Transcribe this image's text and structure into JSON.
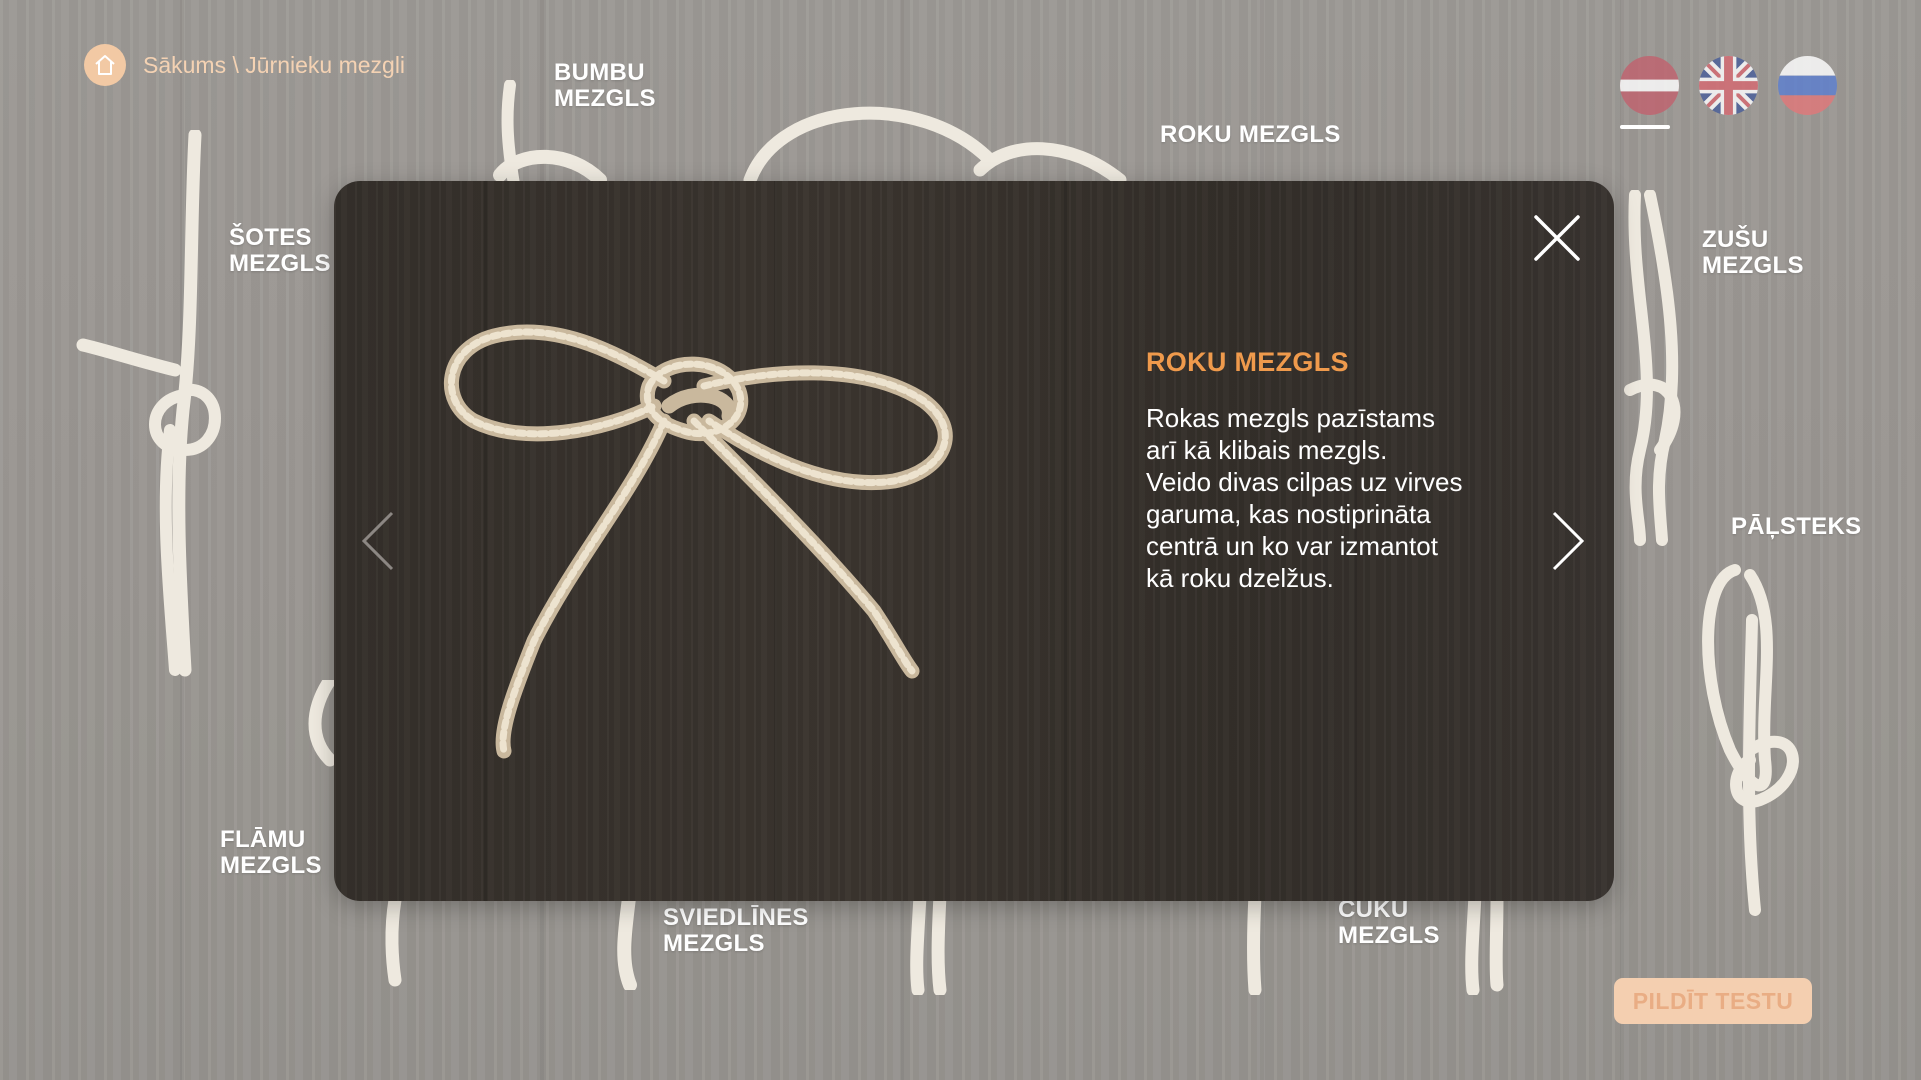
{
  "breadcrumb": {
    "icon": "home-icon",
    "text": "Sākums \\ Jūrnieku mezgli"
  },
  "languages": {
    "items": [
      {
        "code": "lv",
        "icon": "latvia-flag-icon",
        "active": true
      },
      {
        "code": "en",
        "icon": "uk-flag-icon",
        "active": false
      },
      {
        "code": "ru",
        "icon": "russia-flag-icon",
        "active": false
      }
    ]
  },
  "background_knots": [
    {
      "line1": "BUMBU",
      "line2": "MEZGLS"
    },
    {
      "line1": "ROKU MEZGLS",
      "line2": ""
    },
    {
      "line1": "ŠOTES",
      "line2": "MEZGLS"
    },
    {
      "line1": "ZUŠU",
      "line2": "MEZGLS"
    },
    {
      "line1": "PĀĻSTEKS",
      "line2": ""
    },
    {
      "line1": "FLĀMU",
      "line2": "MEZGLS"
    },
    {
      "line1": "SVIEDLĪNES",
      "line2": "MEZGLS"
    },
    {
      "line1": "CŪKU",
      "line2": "MEZGLS"
    }
  ],
  "modal": {
    "title": "ROKU MEZGLS",
    "description": "Rokas mezgls pazīstams\narī kā klibais mezgls.\nVeido divas cilpas uz virves\ngaruma, kas nostiprināta\ncentrā un ko var izmantot\nkā roku dzelžus.",
    "close_icon": "close-icon",
    "prev_icon": "chevron-left-icon",
    "next_icon": "chevron-right-icon"
  },
  "test_button": {
    "label": "PILDĪT TESTU"
  },
  "colors": {
    "accent": "#ef9a4c",
    "button_bg": "#f4cfb0",
    "modal_bg": "#3a342e"
  }
}
